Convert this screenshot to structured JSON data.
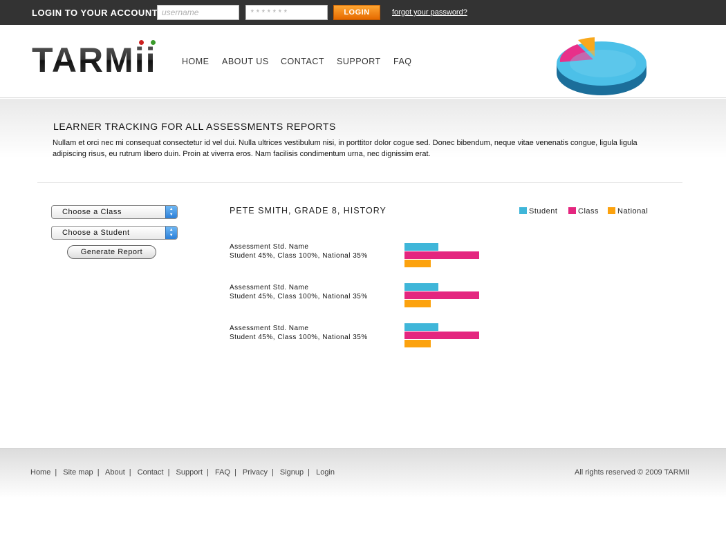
{
  "login": {
    "title": "LOGIN TO YOUR ACCOUNT",
    "username_placeholder": "username",
    "password_placeholder": "* * * * * * *",
    "button_label": "LOGIN",
    "forgot_label": "forgot your password?"
  },
  "header": {
    "logo": "TARMii",
    "nav": [
      "HOME",
      "ABOUT US",
      "CONTACT",
      "SUPPORT",
      "FAQ"
    ]
  },
  "intro": {
    "title": "LEARNER TRACKING FOR ALL ASSESSMENTS REPORTS",
    "text": "Nullam et orci nec mi consequat consectetur id vel dui. Nulla ultrices vestibulum nisi, in porttitor dolor cogue sed. Donec bibendum, neque vitae venenatis congue, ligula ligula adipiscing risus, eu rutrum libero duin. Proin at viverra eros. Nam facilisis condimentum urna, nec dignissim erat."
  },
  "controls": {
    "class_select": "Choose a Class",
    "student_select": "Choose a Student",
    "generate_label": "Generate Report"
  },
  "report": {
    "title": "PETE SMITH, GRADE 8, HISTORY",
    "legend": [
      "Student",
      "Class",
      "National"
    ],
    "colors": {
      "student": "#3fb6d9",
      "class": "#e4267f",
      "national": "#fca20e"
    },
    "rows": [
      {
        "name": "Assessment Std. Name",
        "desc": "Student 45%, Class 100%, National 35%",
        "student": 45,
        "class": 100,
        "national": 35
      },
      {
        "name": "Assessment Std. Name",
        "desc": "Student 45%, Class 100%, National 35%",
        "student": 45,
        "class": 100,
        "national": 35
      },
      {
        "name": "Assessment Std. Name",
        "desc": "Student 45%, Class 100%, National 35%",
        "student": 45,
        "class": 100,
        "national": 35
      }
    ]
  },
  "footer": {
    "links": [
      "Home",
      "Site map",
      "About",
      "Contact",
      "Support",
      "FAQ",
      "Privacy",
      "Signup",
      "Login"
    ],
    "copyright": "All rights reserved © 2009 TARMII"
  }
}
